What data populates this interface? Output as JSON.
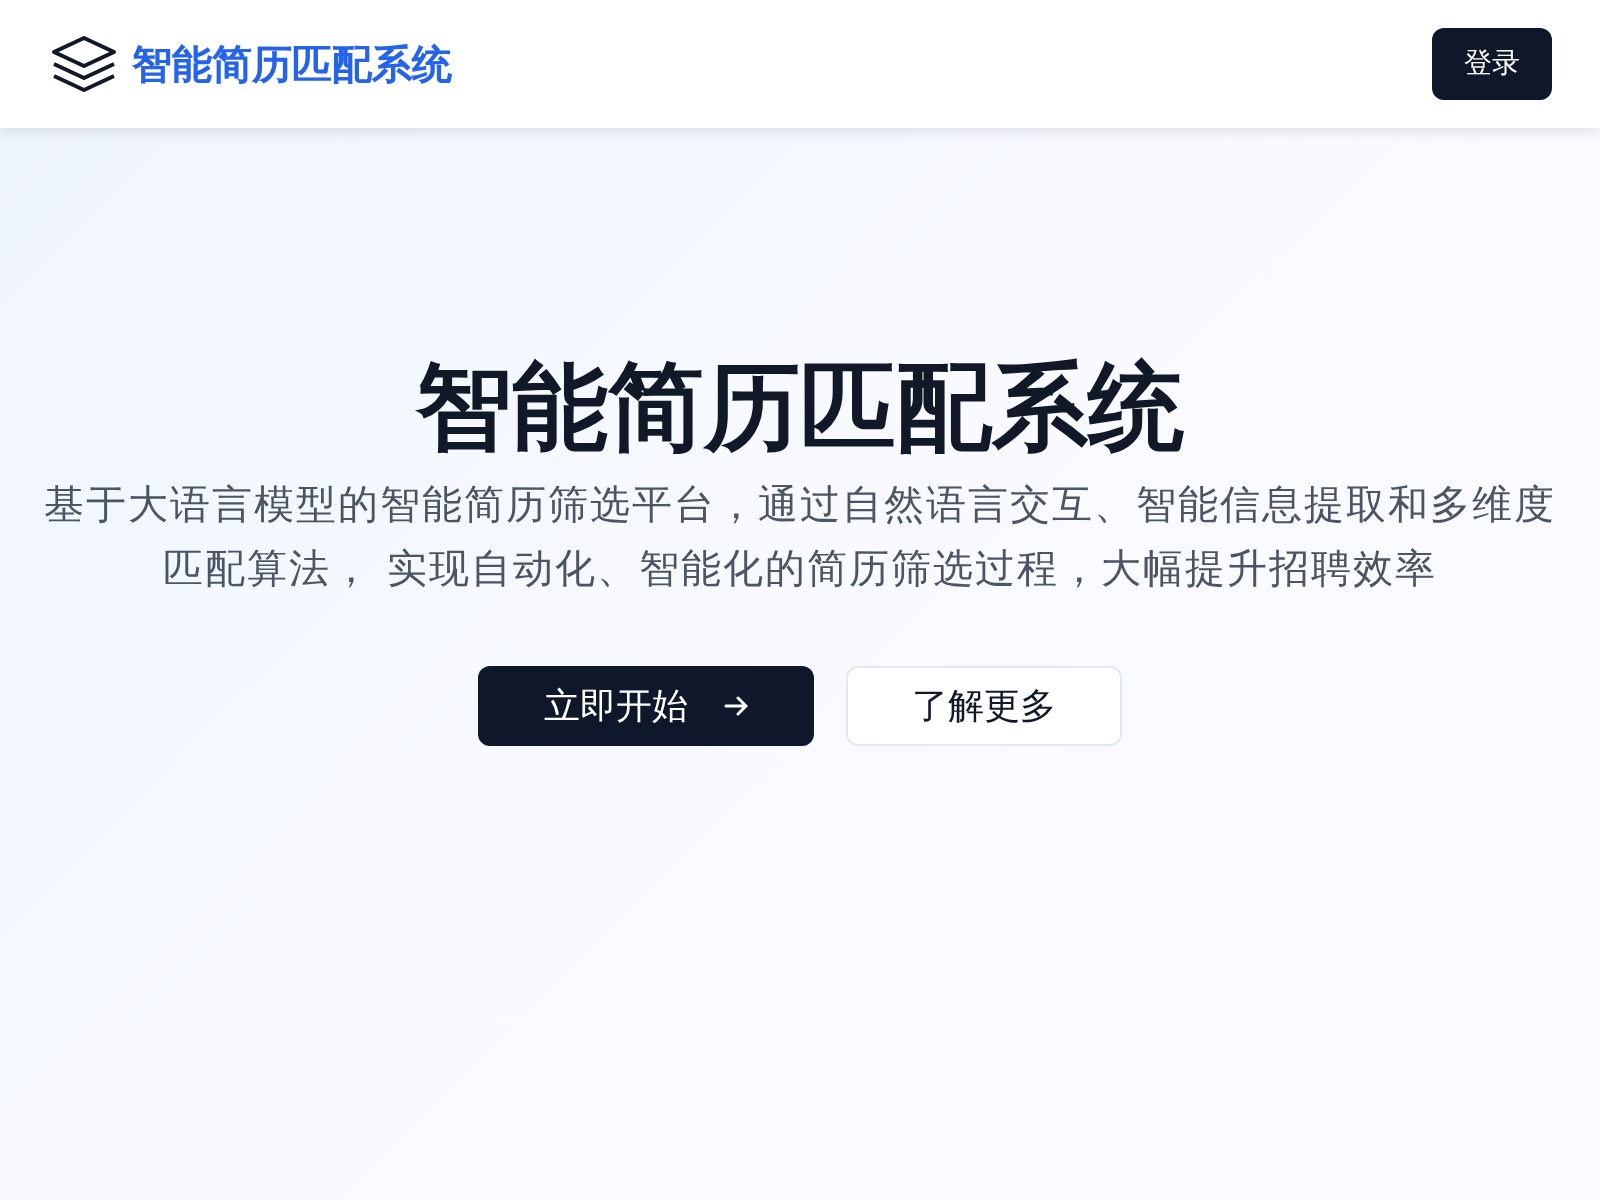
{
  "header": {
    "brand": "智能简历匹配系统",
    "login_button": "登录"
  },
  "hero": {
    "title": "智能简历匹配系统",
    "subtitle": "基于大语言模型的智能简历筛选平台，通过自然语言交互、智能信息提取和多维度匹配算法， 实现自动化、智能化的简历筛选过程，大幅提升招聘效率",
    "buttons": [
      {
        "label": "立即开始",
        "kind": "primary"
      },
      {
        "label": "了解更多",
        "kind": "outline"
      }
    ]
  }
}
